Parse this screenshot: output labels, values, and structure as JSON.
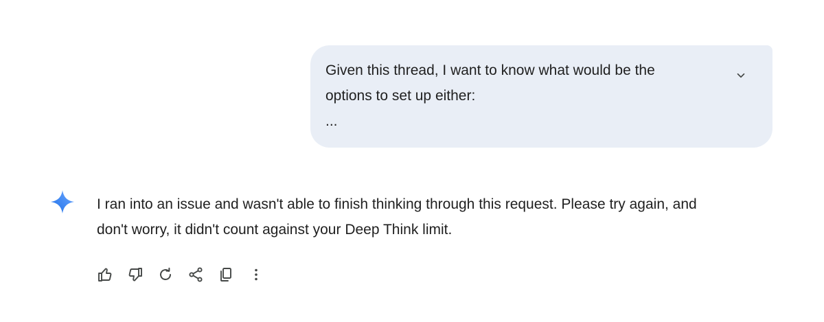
{
  "user_prompt": {
    "lines": [
      "Given this thread, I want to know what would be the",
      "options to set up either:",
      "..."
    ],
    "expand_icon": "chevron-down-icon"
  },
  "response": {
    "avatar_icon": "gemini-sparkle-icon",
    "lines": [
      "I ran into an issue and wasn't able to finish thinking through this request. Please try again, and",
      "don't worry, it didn't count against your Deep Think limit."
    ]
  },
  "actions": [
    {
      "icon": "thumbs-up-icon"
    },
    {
      "icon": "thumbs-down-icon"
    },
    {
      "icon": "regenerate-icon"
    },
    {
      "icon": "share-icon"
    },
    {
      "icon": "copy-icon"
    },
    {
      "icon": "more-vert-icon"
    }
  ],
  "colors": {
    "bubble_bg": "#e9eef6",
    "text": "#1f1f1f",
    "icon": "#444746",
    "sparkle": "#4285f4"
  }
}
